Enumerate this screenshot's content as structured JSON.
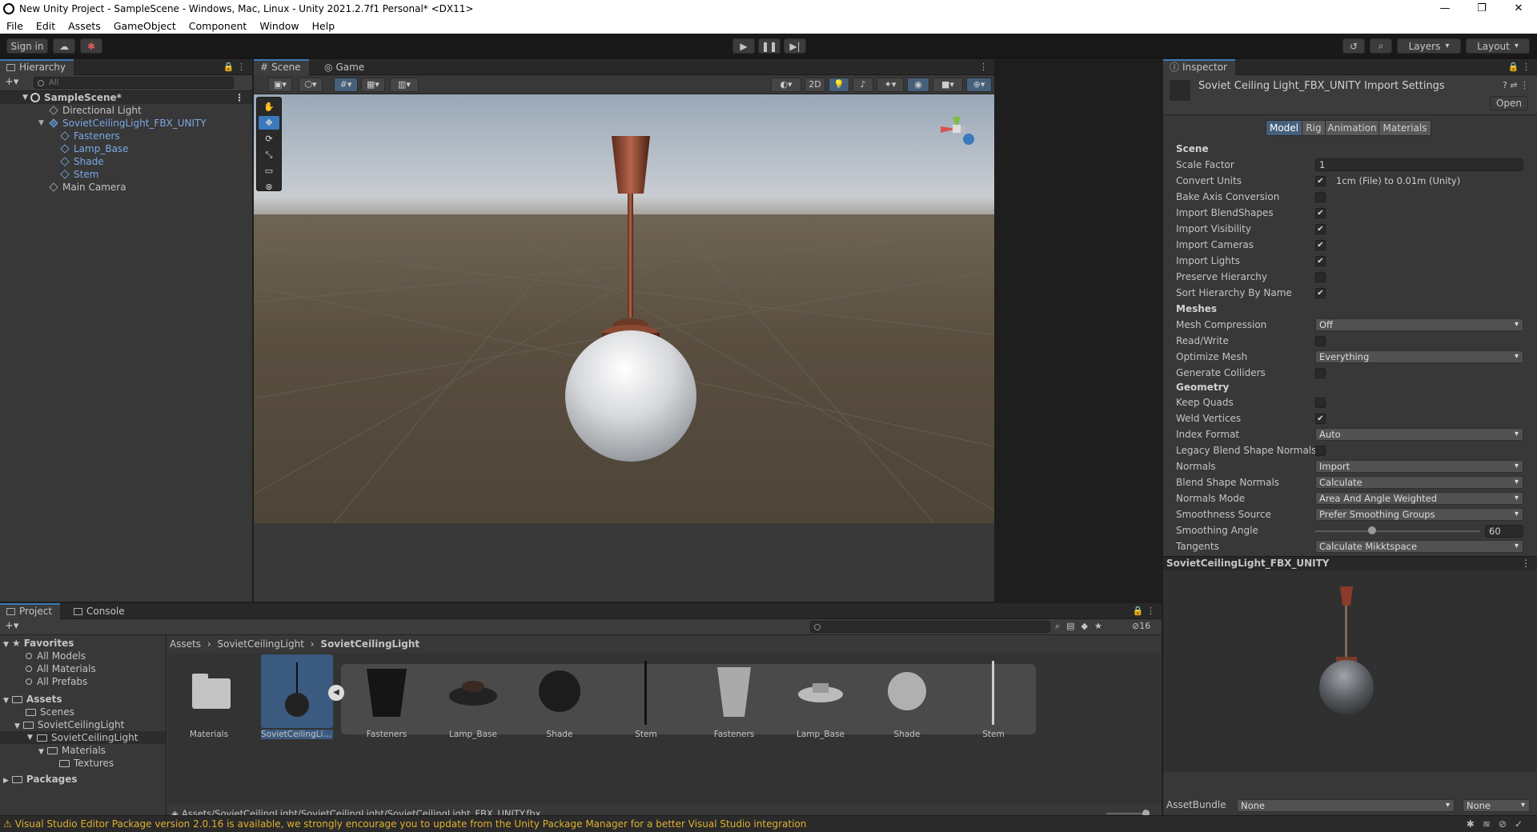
{
  "window": {
    "title": "New Unity Project - SampleScene - Windows, Mac, Linux - Unity 2021.2.7f1 Personal* <DX11>"
  },
  "menu": [
    "File",
    "Edit",
    "Assets",
    "GameObject",
    "Component",
    "Window",
    "Help"
  ],
  "toolbar": {
    "sign_in": "Sign in",
    "layers": "Layers",
    "layout": "Layout"
  },
  "hierarchy": {
    "tab": "Hierarchy",
    "search_placeholder": "All",
    "items": [
      {
        "label": "SampleScene*"
      },
      {
        "label": "Directional Light"
      },
      {
        "label": "SovietCeilingLight_FBX_UNITY"
      },
      {
        "label": "Fasteners"
      },
      {
        "label": "Lamp_Base"
      },
      {
        "label": "Shade"
      },
      {
        "label": "Stem"
      },
      {
        "label": "Main Camera"
      }
    ]
  },
  "scene": {
    "tabs": [
      "Scene",
      "Game"
    ],
    "mode_2d": "2D"
  },
  "inspector": {
    "tab": "Inspector",
    "title": "Soviet Ceiling Light_FBX_UNITY Import Settings",
    "open": "Open",
    "tabs": [
      "Model",
      "Rig",
      "Animation",
      "Materials"
    ],
    "sections": {
      "scene": "Scene",
      "meshes": "Meshes",
      "geometry": "Geometry"
    },
    "scale_factor": {
      "label": "Scale Factor",
      "value": "1"
    },
    "convert_units": {
      "label": "Convert Units",
      "value": "1cm (File) to 0.01m (Unity)"
    },
    "bake_axis": {
      "label": "Bake Axis Conversion"
    },
    "import_blendshapes": {
      "label": "Import BlendShapes"
    },
    "import_visibility": {
      "label": "Import Visibility"
    },
    "import_cameras": {
      "label": "Import Cameras"
    },
    "import_lights": {
      "label": "Import Lights"
    },
    "preserve_hierarchy": {
      "label": "Preserve Hierarchy"
    },
    "sort_hierarchy": {
      "label": "Sort Hierarchy By Name"
    },
    "mesh_compression": {
      "label": "Mesh Compression",
      "value": "Off"
    },
    "read_write": {
      "label": "Read/Write"
    },
    "optimize_mesh": {
      "label": "Optimize Mesh",
      "value": "Everything"
    },
    "generate_colliders": {
      "label": "Generate Colliders"
    },
    "keep_quads": {
      "label": "Keep Quads"
    },
    "weld_vertices": {
      "label": "Weld Vertices"
    },
    "index_format": {
      "label": "Index Format",
      "value": "Auto"
    },
    "legacy_blend": {
      "label": "Legacy Blend Shape Normals"
    },
    "normals": {
      "label": "Normals",
      "value": "Import"
    },
    "blend_shape_normals": {
      "label": "Blend Shape Normals",
      "value": "Calculate"
    },
    "normals_mode": {
      "label": "Normals Mode",
      "value": "Area And Angle Weighted"
    },
    "smoothness_source": {
      "label": "Smoothness Source",
      "value": "Prefer Smoothing Groups"
    },
    "smoothing_angle": {
      "label": "Smoothing Angle",
      "value": "60"
    },
    "tangents": {
      "label": "Tangents",
      "value": "Calculate Mikktspace"
    },
    "preview_title": "SovietCeilingLight_FBX_UNITY",
    "assetbundle": {
      "label": "AssetBundle",
      "value": "None",
      "variant": "None"
    }
  },
  "project": {
    "tabs": [
      "Project",
      "Console"
    ],
    "badge": "16",
    "tree": {
      "favorites": "Favorites",
      "fav_items": [
        "All Models",
        "All Materials",
        "All Prefabs"
      ],
      "assets": "Assets",
      "scenes": "Scenes",
      "soviet1": "SovietCeilingLight",
      "soviet2": "SovietCeilingLight",
      "materials": "Materials",
      "textures": "Textures",
      "packages": "Packages"
    },
    "breadcrumb": [
      "Assets",
      "SovietCeilingLight",
      "SovietCeilingLight"
    ],
    "assets": [
      "Materials",
      "SovietCeilingLight...",
      "Fasteners",
      "Lamp_Base",
      "Shade",
      "Stem",
      "Fasteners",
      "Lamp_Base",
      "Shade",
      "Stem"
    ],
    "path": "Assets/SovietCeilingLight/SovietCeilingLight/SovietCeilingLight_FBX_UNITY.fbx"
  },
  "status": "Visual Studio Editor Package version 2.0.16 is available, we strongly encourage you to update from the Unity Package Manager for a better Visual Studio integration",
  "checks": {
    "convert_units": true,
    "bake_axis": false,
    "import_blendshapes": true,
    "import_visibility": true,
    "import_cameras": true,
    "import_lights": true,
    "preserve_hierarchy": false,
    "sort_hierarchy": true,
    "read_write": false,
    "generate_colliders": false,
    "keep_quads": false,
    "weld_vertices": true,
    "legacy_blend": false
  }
}
